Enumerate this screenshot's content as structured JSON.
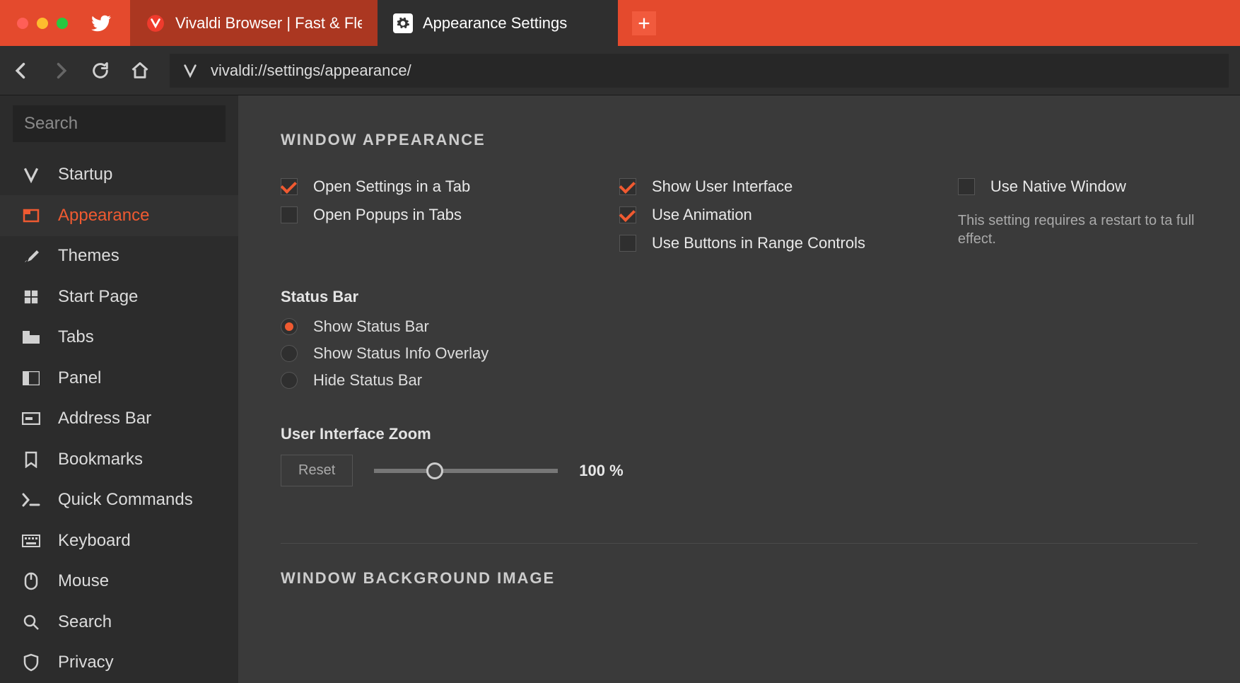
{
  "tabs": {
    "vivaldi_title": "Vivaldi Browser | Fast & Flexib",
    "settings_title": "Appearance Settings"
  },
  "address_url": "vivaldi://settings/appearance/",
  "sidebar": {
    "search_placeholder": "Search",
    "items": [
      "Startup",
      "Appearance",
      "Themes",
      "Start Page",
      "Tabs",
      "Panel",
      "Address Bar",
      "Bookmarks",
      "Quick Commands",
      "Keyboard",
      "Mouse",
      "Search",
      "Privacy"
    ]
  },
  "section_window_appearance": "WINDOW APPEARANCE",
  "checkboxes": {
    "open_settings_tab": "Open Settings in a Tab",
    "open_popups_tabs": "Open Popups in Tabs",
    "show_ui": "Show User Interface",
    "use_animation": "Use Animation",
    "use_buttons_range": "Use Buttons in Range Controls",
    "use_native_window": "Use Native Window",
    "native_hint": "This setting requires a restart to ta full effect."
  },
  "status_bar": {
    "title": "Status Bar",
    "show": "Show Status Bar",
    "overlay": "Show Status Info Overlay",
    "hide": "Hide Status Bar"
  },
  "zoom": {
    "title": "User Interface Zoom",
    "reset": "Reset",
    "value": "100 %"
  },
  "section_bg_image": "WINDOW BACKGROUND IMAGE"
}
